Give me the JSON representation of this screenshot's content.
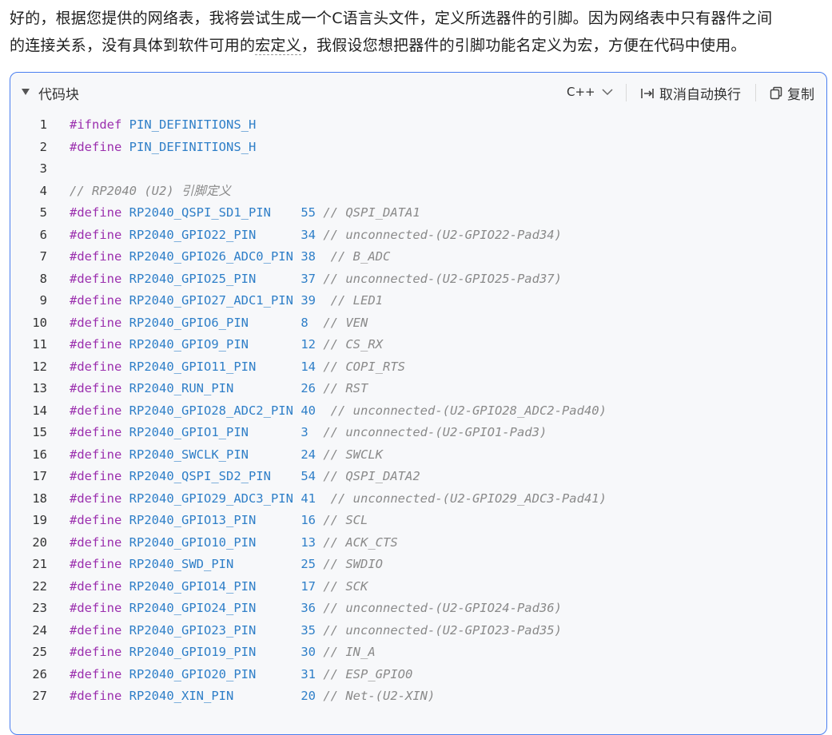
{
  "intro": {
    "line1": "好的，根据您提供的网络表，我将尝试生成一个C语言头文件，定义所选器件的引脚。因为网络表中只有器件之间",
    "line2_before": "的连接关系，没有具体到软件可用的",
    "line2_underlined": "宏定义",
    "line2_after": "，我假设您想把器件的引脚功能名定义为宏，方便在代码中使用。"
  },
  "code_block": {
    "title": "代码块",
    "language": "C++",
    "wrap_label": "取消自动换行",
    "copy_label": "复制",
    "lines": [
      {
        "n": "1",
        "kw": "#ifndef",
        "mac": "PIN_DEFINITIONS_H",
        "pad": "",
        "num": "",
        "cm": ""
      },
      {
        "n": "2",
        "kw": "#define",
        "mac": "PIN_DEFINITIONS_H",
        "pad": "",
        "num": "",
        "cm": ""
      },
      {
        "n": "3",
        "kw": "",
        "mac": "",
        "pad": "",
        "num": "",
        "cm": ""
      },
      {
        "n": "4",
        "kw": "",
        "mac": "",
        "pad": "",
        "num": "",
        "cm": "// RP2040 (U2) 引脚定义"
      },
      {
        "n": "5",
        "kw": "#define",
        "mac": "RP2040_QSPI_SD1_PIN",
        "pad": "   ",
        "num": "55",
        "cm": "// QSPI_DATA1"
      },
      {
        "n": "6",
        "kw": "#define",
        "mac": "RP2040_GPIO22_PIN",
        "pad": "     ",
        "num": "34",
        "cm": "// unconnected-(U2-GPIO22-Pad34)"
      },
      {
        "n": "7",
        "kw": "#define",
        "mac": "RP2040_GPIO26_ADC0_PIN",
        "pad": "",
        "num": "38",
        "cm": " // B_ADC"
      },
      {
        "n": "8",
        "kw": "#define",
        "mac": "RP2040_GPIO25_PIN",
        "pad": "     ",
        "num": "37",
        "cm": "// unconnected-(U2-GPIO25-Pad37)"
      },
      {
        "n": "9",
        "kw": "#define",
        "mac": "RP2040_GPIO27_ADC1_PIN",
        "pad": "",
        "num": "39",
        "cm": " // LED1"
      },
      {
        "n": "10",
        "kw": "#define",
        "mac": "RP2040_GPIO6_PIN",
        "pad": "      ",
        "num": "8 ",
        "cm": "// VEN"
      },
      {
        "n": "11",
        "kw": "#define",
        "mac": "RP2040_GPIO9_PIN",
        "pad": "      ",
        "num": "12",
        "cm": "// CS_RX"
      },
      {
        "n": "12",
        "kw": "#define",
        "mac": "RP2040_GPIO11_PIN",
        "pad": "     ",
        "num": "14",
        "cm": "// COPI_RTS"
      },
      {
        "n": "13",
        "kw": "#define",
        "mac": "RP2040_RUN_PIN",
        "pad": "        ",
        "num": "26",
        "cm": "// RST"
      },
      {
        "n": "14",
        "kw": "#define",
        "mac": "RP2040_GPIO28_ADC2_PIN",
        "pad": "",
        "num": "40",
        "cm": " // unconnected-(U2-GPIO28_ADC2-Pad40)"
      },
      {
        "n": "15",
        "kw": "#define",
        "mac": "RP2040_GPIO1_PIN",
        "pad": "      ",
        "num": "3 ",
        "cm": "// unconnected-(U2-GPIO1-Pad3)"
      },
      {
        "n": "16",
        "kw": "#define",
        "mac": "RP2040_SWCLK_PIN",
        "pad": "      ",
        "num": "24",
        "cm": "// SWCLK"
      },
      {
        "n": "17",
        "kw": "#define",
        "mac": "RP2040_QSPI_SD2_PIN",
        "pad": "   ",
        "num": "54",
        "cm": "// QSPI_DATA2"
      },
      {
        "n": "18",
        "kw": "#define",
        "mac": "RP2040_GPIO29_ADC3_PIN",
        "pad": "",
        "num": "41",
        "cm": " // unconnected-(U2-GPIO29_ADC3-Pad41)"
      },
      {
        "n": "19",
        "kw": "#define",
        "mac": "RP2040_GPIO13_PIN",
        "pad": "     ",
        "num": "16",
        "cm": "// SCL"
      },
      {
        "n": "20",
        "kw": "#define",
        "mac": "RP2040_GPIO10_PIN",
        "pad": "     ",
        "num": "13",
        "cm": "// ACK_CTS"
      },
      {
        "n": "21",
        "kw": "#define",
        "mac": "RP2040_SWD_PIN",
        "pad": "        ",
        "num": "25",
        "cm": "// SWDIO"
      },
      {
        "n": "22",
        "kw": "#define",
        "mac": "RP2040_GPIO14_PIN",
        "pad": "     ",
        "num": "17",
        "cm": "// SCK"
      },
      {
        "n": "23",
        "kw": "#define",
        "mac": "RP2040_GPIO24_PIN",
        "pad": "     ",
        "num": "36",
        "cm": "// unconnected-(U2-GPIO24-Pad36)"
      },
      {
        "n": "24",
        "kw": "#define",
        "mac": "RP2040_GPIO23_PIN",
        "pad": "     ",
        "num": "35",
        "cm": "// unconnected-(U2-GPIO23-Pad35)"
      },
      {
        "n": "25",
        "kw": "#define",
        "mac": "RP2040_GPIO19_PIN",
        "pad": "     ",
        "num": "30",
        "cm": "// IN_A"
      },
      {
        "n": "26",
        "kw": "#define",
        "mac": "RP2040_GPIO20_PIN",
        "pad": "     ",
        "num": "31",
        "cm": "// ESP_GPIO0"
      },
      {
        "n": "27",
        "kw": "#define",
        "mac": "RP2040_XIN_PIN",
        "pad": "        ",
        "num": "20",
        "cm": "// Net-(U2-XIN)"
      }
    ]
  }
}
